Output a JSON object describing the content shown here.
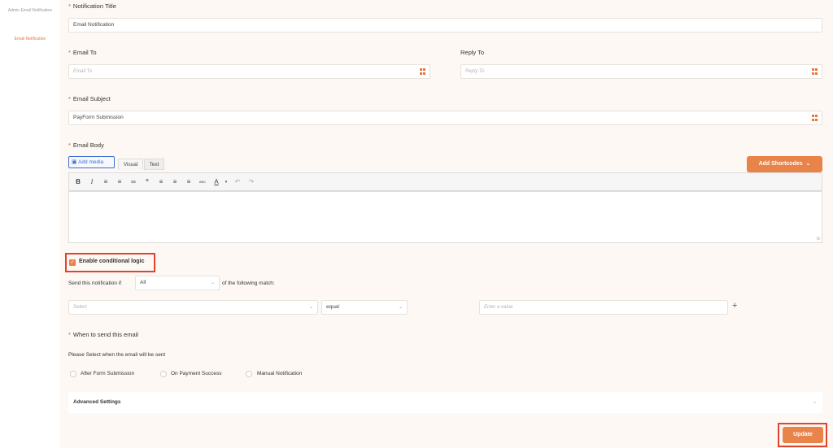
{
  "sidebar": {
    "items": [
      {
        "label": "Admin Email Notification",
        "active": false
      },
      {
        "label": "Email Notification",
        "active": true
      }
    ]
  },
  "form": {
    "notification_title": {
      "label": "Notification Title",
      "value": "Email Notification"
    },
    "email_to": {
      "label": "Email To",
      "placeholder": "Email To"
    },
    "reply_to": {
      "label": "Reply To",
      "placeholder": "Reply To"
    },
    "email_subject": {
      "label": "Email Subject",
      "value": "PayForm Submission"
    },
    "email_body": {
      "label": "Email Body",
      "add_media_label": "Add media",
      "tab_visual": "Visual",
      "tab_text": "Text",
      "add_shortcodes_label": "Add Shortcodes",
      "toolbar_icons": [
        "bold-icon",
        "italic-icon",
        "bullet-list-icon",
        "numbered-list-icon",
        "link-icon",
        "blockquote-icon",
        "align-left-icon",
        "align-center-icon",
        "align-right-icon",
        "spellcheck-icon",
        "text-color-icon",
        "undo-icon",
        "redo-icon"
      ]
    },
    "conditional": {
      "enable_label": "Enable conditional logic",
      "enabled": true,
      "send_if_prefix": "Send this notification if",
      "match_value": "All",
      "send_if_suffix": "of the following match:",
      "field_placeholder": "Select",
      "operator_value": "equal",
      "value_placeholder": "Enter a value",
      "add_symbol": "+"
    },
    "when_to_send": {
      "label": "When to send this email",
      "help": "Please Select when the email will be sent",
      "options": [
        "After Form Submission",
        "On Payment Success",
        "Manual Notification"
      ]
    },
    "advanced_settings_label": "Advanced Settings",
    "update_label": "Update"
  },
  "colors": {
    "accent": "#e8834a",
    "highlight": "#e0442d",
    "required": "#e14d3b"
  }
}
